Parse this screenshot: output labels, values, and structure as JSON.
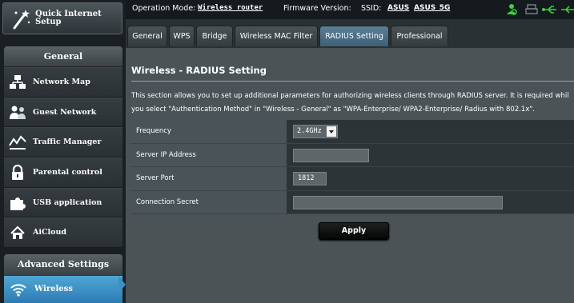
{
  "sidebar": {
    "quick_setup": "Quick Internet\nSetup",
    "general_header": "General",
    "items": [
      {
        "label": "Network Map",
        "icon": "network-map-icon"
      },
      {
        "label": "Guest Network",
        "icon": "guest-network-icon"
      },
      {
        "label": "Traffic Manager",
        "icon": "traffic-manager-icon"
      },
      {
        "label": "Parental control",
        "icon": "lock-icon"
      },
      {
        "label": "USB application",
        "icon": "puzzle-icon"
      },
      {
        "label": "AiCloud",
        "icon": "cloud-home-icon"
      }
    ],
    "advanced_header": "Advanced Settings",
    "active_item": {
      "label": "Wireless",
      "icon": "wifi-icon"
    }
  },
  "topbar": {
    "op_mode_label": "Operation Mode:",
    "op_mode_value": "Wireless router",
    "firmware_label": "Firmware Version:",
    "ssid_label": "SSID:",
    "ssid_1": "ASUS",
    "ssid_2": "ASUS_5G"
  },
  "tabs": [
    {
      "label": "General"
    },
    {
      "label": "WPS"
    },
    {
      "label": "Bridge"
    },
    {
      "label": "Wireless MAC Filter"
    },
    {
      "label": "RADIUS Setting"
    },
    {
      "label": "Professional"
    }
  ],
  "active_tab": "RADIUS Setting",
  "page": {
    "title": "Wireless - RADIUS Setting",
    "description": "This section allows you to set up additional parameters for authorizing wireless clients through RADIUS server. It is required whil\nyou select \"Authentication Method\" in \"Wireless - General\" as \"WPA-Enterprise/ WPA2-Enterprise/ Radius with 802.1x\"."
  },
  "form": {
    "frequency_label": "Frequency",
    "frequency_value": "2.4GHz",
    "server_ip_label": "Server IP Address",
    "server_ip_value": "",
    "server_port_label": "Server Port",
    "server_port_value": "1812",
    "secret_label": "Connection Secret",
    "secret_value": ""
  },
  "apply_label": "Apply",
  "colors": {
    "accent": "#3a8fc7",
    "status_green": "#3ad13a",
    "panel": "#4b5356"
  }
}
